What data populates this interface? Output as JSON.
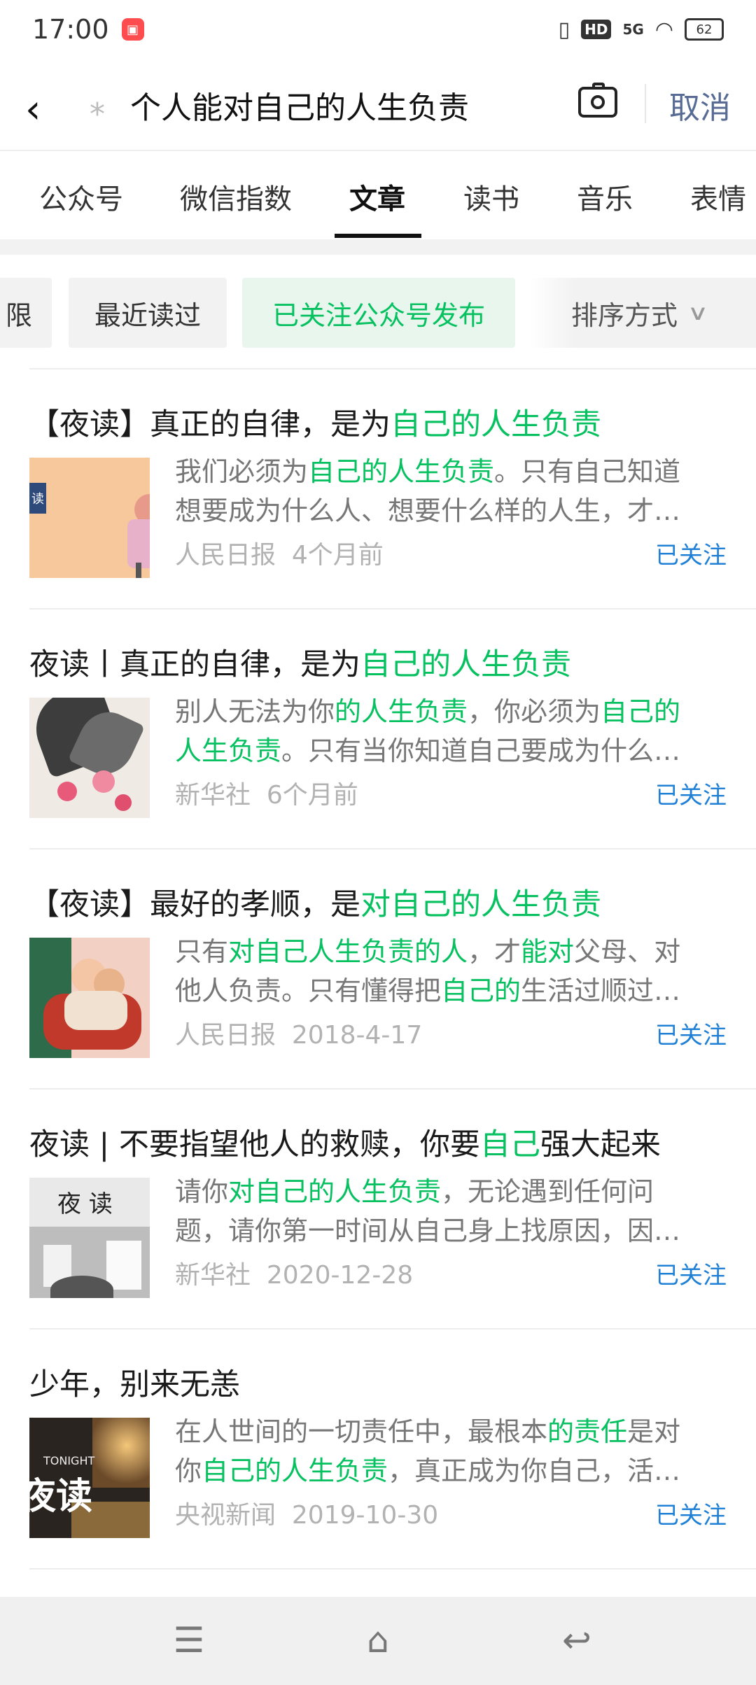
{
  "status": {
    "time": "17:00",
    "hd": "HD",
    "network": "5G",
    "battery": "62"
  },
  "search": {
    "query": "个人能对自己的人生负责",
    "cancel_label": "取消"
  },
  "tabs": [
    {
      "label": "公众号"
    },
    {
      "label": "微信指数"
    },
    {
      "label": "文章"
    },
    {
      "label": "读书"
    },
    {
      "label": "音乐"
    },
    {
      "label": "表情"
    }
  ],
  "filters": {
    "chips": [
      "限",
      "最近读过",
      "已关注公众号发布"
    ],
    "sort_label": "排序方式"
  },
  "articles": [
    {
      "title": [
        {
          "t": "【夜读】真正的自律，是为"
        },
        {
          "t": "自己的人生负责",
          "hl": true
        }
      ],
      "snippet1": [
        {
          "t": "我们必须为"
        },
        {
          "t": "自己的人生负责",
          "hl": true
        },
        {
          "t": "。只有自己知道"
        }
      ],
      "snippet2": [
        {
          "t": "想要成为什么人、想要什么样的人生，才…"
        }
      ],
      "source": "人民日报",
      "date": "4个月前",
      "follow": "已关注"
    },
    {
      "title": [
        {
          "t": "夜读丨真正的自律，是为"
        },
        {
          "t": "自己的人生负责",
          "hl": true
        }
      ],
      "snippet1": [
        {
          "t": "别人无法为你"
        },
        {
          "t": "的人生负责",
          "hl": true
        },
        {
          "t": "，你必须为"
        },
        {
          "t": "自己的",
          "hl": true
        }
      ],
      "snippet2": [
        {
          "t": "人生负责",
          "hl": true
        },
        {
          "t": "。只有当你知道自己要成为什么…"
        }
      ],
      "source": "新华社",
      "date": "6个月前",
      "follow": "已关注"
    },
    {
      "title": [
        {
          "t": "【夜读】最好的孝顺，是"
        },
        {
          "t": "对自己的人生负责",
          "hl": true
        }
      ],
      "snippet1": [
        {
          "t": "只有"
        },
        {
          "t": "对自己人生负责的人",
          "hl": true
        },
        {
          "t": "，才"
        },
        {
          "t": "能对",
          "hl": true
        },
        {
          "t": "父母、对"
        }
      ],
      "snippet2": [
        {
          "t": "他人负责。只有懂得把"
        },
        {
          "t": "自己的",
          "hl": true
        },
        {
          "t": "生活过顺过…"
        }
      ],
      "source": "人民日报",
      "date": "2018-4-17",
      "follow": "已关注"
    },
    {
      "title": [
        {
          "t": "夜读 | 不要指望他人的救赎，你要"
        },
        {
          "t": "自己",
          "hl": true
        },
        {
          "t": "强大起来"
        }
      ],
      "snippet1": [
        {
          "t": "请你"
        },
        {
          "t": "对自己的人生负责",
          "hl": true
        },
        {
          "t": "，无论遇到任何问"
        }
      ],
      "snippet2": [
        {
          "t": "题，请你第一时间从自己身上找原因，因…"
        }
      ],
      "source": "新华社",
      "date": "2020-12-28",
      "follow": "已关注"
    },
    {
      "title": [
        {
          "t": "少年，别来无恙"
        }
      ],
      "snippet1": [
        {
          "t": "在人世间的一切责任中，最根本"
        },
        {
          "t": "的责任",
          "hl": true
        },
        {
          "t": "是对"
        }
      ],
      "snippet2": [
        {
          "t": "你"
        },
        {
          "t": "自己的人生负责",
          "hl": true
        },
        {
          "t": "，真正成为你自己，活…"
        }
      ],
      "source": "央视新闻",
      "date": "2019-10-30",
      "follow": "已关注"
    }
  ],
  "thumbs": {
    "t1_text": "读",
    "t4_text": "夜 读",
    "t5_small": "TONIGHT",
    "t5_big": "夜读"
  },
  "colors": {
    "accent_green": "#07c160",
    "link_blue": "#1f80d6",
    "cancel_blue": "#576b95"
  }
}
